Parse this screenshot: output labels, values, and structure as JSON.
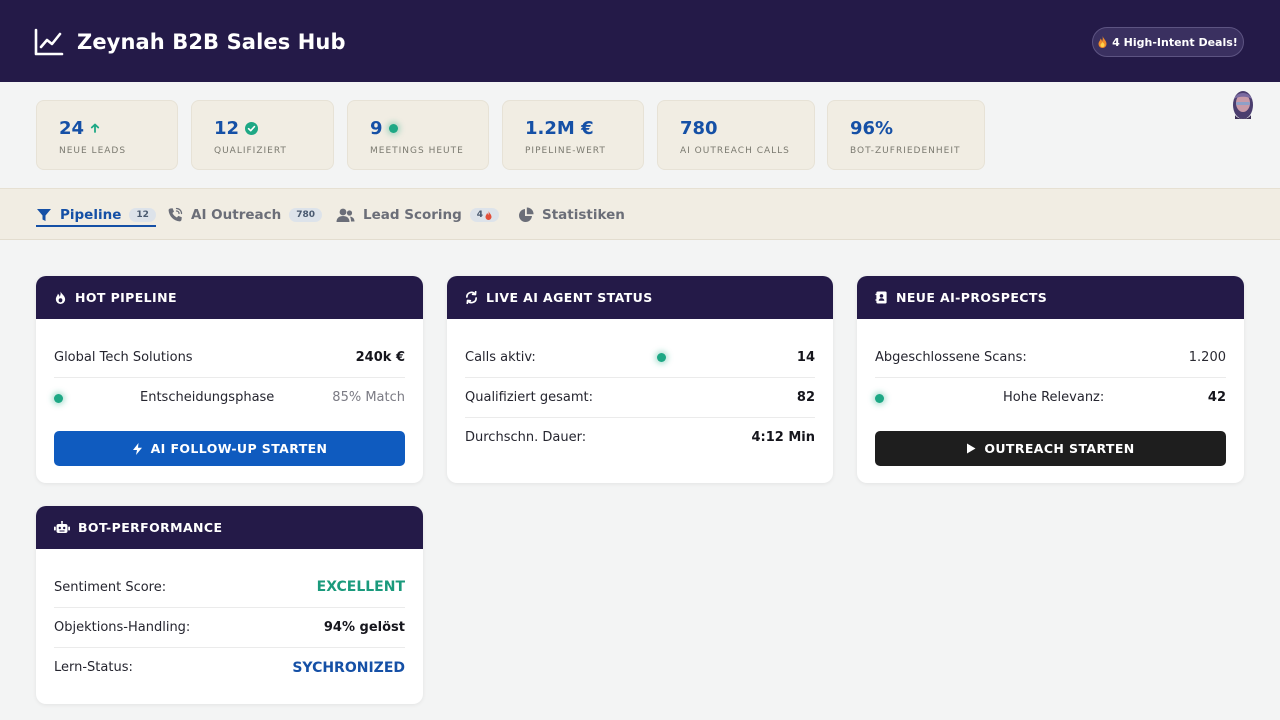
{
  "header": {
    "title": "Zeynah B2B Sales Hub",
    "deals_badge": "4 High-Intent Deals!"
  },
  "stats": [
    {
      "value": "24",
      "label": "NEUE LEADS",
      "indicator": "arrow-up-icon"
    },
    {
      "value": "12",
      "label": "QUALIFIZIERT",
      "indicator": "check-circle-icon"
    },
    {
      "value": "9",
      "label": "MEETINGS HEUTE",
      "indicator": "live-dot"
    },
    {
      "value": "1.2M €",
      "label": "PIPELINE-WERT"
    },
    {
      "value": "780",
      "label": "AI OUTREACH CALLS"
    },
    {
      "value": "96%",
      "label": "BOT-ZUFRIEDENHEIT"
    }
  ],
  "tabs": [
    {
      "label": "Pipeline",
      "badge": "12",
      "icon": "funnel-icon",
      "active": true
    },
    {
      "label": "AI Outreach",
      "badge": "780",
      "icon": "phone-icon"
    },
    {
      "label": "Lead Scoring",
      "badge": "4",
      "icon": "users-icon"
    },
    {
      "label": "Statistiken",
      "icon": "pie-chart-icon"
    }
  ],
  "cards": {
    "hot_pipeline": {
      "title": "HOT PIPELINE",
      "company": "Global Tech Solutions",
      "amount": "240k €",
      "phase": "Entscheidungsphase",
      "match": "85% Match",
      "button": "AI FOLLOW-UP STARTEN"
    },
    "agent_status": {
      "title": "LIVE AI AGENT STATUS",
      "rows": [
        {
          "label": "Calls aktiv:",
          "value": "14"
        },
        {
          "label": "Qualifiziert gesamt:",
          "value": "82"
        },
        {
          "label": "Durchschn. Dauer:",
          "value": "4:12 Min"
        }
      ]
    },
    "prospects": {
      "title": "NEUE AI-PROSPECTS",
      "scans_label": "Abgeschlossene Scans:",
      "scans_value": "1.200",
      "relevance_label": "Hohe Relevanz:",
      "relevance_value": "42",
      "button": "OUTREACH STARTEN"
    },
    "bot_performance": {
      "title": "BOT-PERFORMANCE",
      "rows": [
        {
          "label": "Sentiment Score:",
          "value": "EXCELLENT"
        },
        {
          "label": "Objektions-Handling:",
          "value": "94% gelöst"
        },
        {
          "label": "Lern-Status:",
          "value": "SYCHRONIZED"
        }
      ]
    }
  },
  "colors": {
    "header_bg": "#241a48",
    "accent_blue": "#1550a6",
    "accent_green": "#1a9a7c",
    "button_blue": "#0f5bbf",
    "button_black": "#1e1e1e",
    "stat_card_bg": "#f1ede3"
  }
}
